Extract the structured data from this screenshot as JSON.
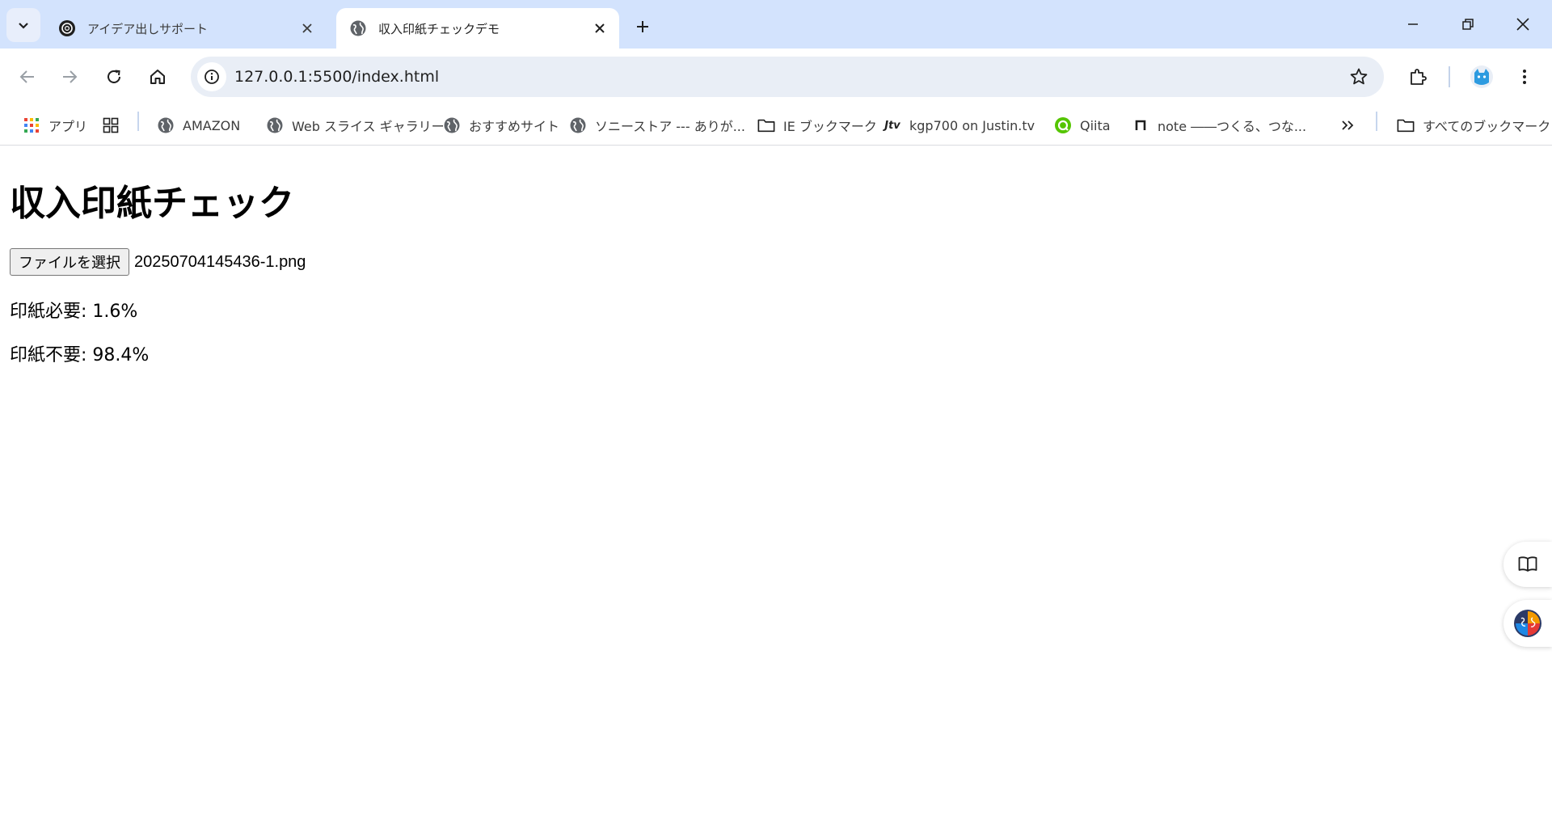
{
  "tabs": [
    {
      "title": "アイデア出しサポート",
      "favicon": "openai-icon",
      "active": false
    },
    {
      "title": "収入印紙チェックデモ",
      "favicon": "globe-icon",
      "active": true
    }
  ],
  "toolbar": {
    "url": "127.0.0.1:5500/index.html"
  },
  "bookmarks": [
    {
      "label": "アプリ",
      "icon": "apps-grid-icon"
    },
    {
      "label": "",
      "icon": "tab-groups-icon"
    },
    {
      "label": "AMAZON",
      "icon": "globe-icon"
    },
    {
      "label": "Web スライス ギャラリー",
      "icon": "globe-icon"
    },
    {
      "label": "おすすめサイト",
      "icon": "globe-icon"
    },
    {
      "label": "ソニーストア --- ありが...",
      "icon": "globe-icon"
    },
    {
      "label": "IE ブックマーク",
      "icon": "folder-icon"
    },
    {
      "label": "kgp700 on Justin.tv",
      "icon": "jtv-icon"
    },
    {
      "label": "Qiita",
      "icon": "qiita-icon"
    },
    {
      "label": "note ――つくる、つな...",
      "icon": "note-icon"
    },
    {
      "label": "すべてのブックマーク",
      "icon": "folder-icon"
    }
  ],
  "page": {
    "heading": "収入印紙チェック",
    "file_button": "ファイルを選択",
    "file_name": "20250704145436-1.png",
    "results": [
      {
        "label": "印紙必要",
        "value": "1.6%"
      },
      {
        "label": "印紙不要",
        "value": "98.4%"
      }
    ]
  },
  "colors": {
    "tabstrip_bg": "#d3e3fd",
    "omnibox_bg": "#e9eef6",
    "page_bg": "#ffffff"
  }
}
